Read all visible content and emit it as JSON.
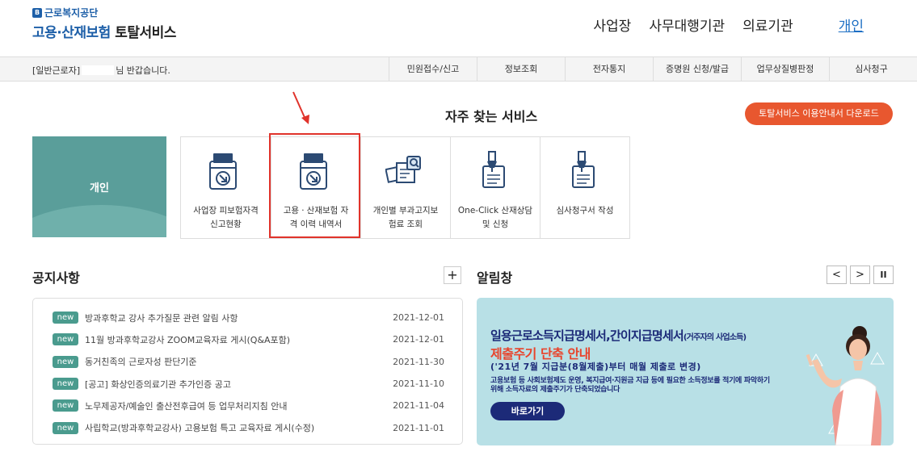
{
  "header": {
    "logo_top": "근로복지공단",
    "logo_main_blue": "고용·산재보험",
    "logo_main_dark": "토탈서비스",
    "nav": [
      "사업장",
      "사무대행기관",
      "의료기관",
      "개인"
    ]
  },
  "subbar": {
    "welcome_prefix": "[일반근로자]",
    "welcome_suffix": "님 반갑습니다.",
    "menu": [
      "민원접수/신고",
      "정보조회",
      "전자통지",
      "증명원 신청/발급",
      "업무상질병판정",
      "심사청구"
    ]
  },
  "favorites": {
    "title": "자주 찾는 서비스",
    "download_label": "토탈서비스 이용안내서 다운로드",
    "personal_label": "개인",
    "items": [
      {
        "line1": "사업장 피보험자격",
        "line2": "신고현황",
        "icon": "folder-arrow-icon"
      },
      {
        "line1": "고용ㆍ산재보험 자",
        "line2": "격 이력 내역서",
        "icon": "folder-arrow-icon"
      },
      {
        "line1": "개인별 부과고지보",
        "line2": "험료 조회",
        "icon": "document-search-icon"
      },
      {
        "line1": "One-Click 산재상담",
        "line2": "및 신청",
        "icon": "pen-document-icon"
      },
      {
        "line1": "심사청구서 작성",
        "line2": "",
        "icon": "pen-document-icon"
      }
    ]
  },
  "notices": {
    "title": "공지사항",
    "more": "+",
    "badge": "new",
    "items": [
      {
        "title": "방과후학교 강사 추가질문 관련 알림 사항",
        "date": "2021-12-01"
      },
      {
        "title": "11월 방과후학교강사 ZOOM교육자료 게시(Q&A포함)",
        "date": "2021-12-01"
      },
      {
        "title": "동거친족의 근로자성 판단기준",
        "date": "2021-11-30"
      },
      {
        "title": "[공고] 화상인증의료기관 추가인증 공고",
        "date": "2021-11-10"
      },
      {
        "title": "노무제공자/예술인 출산전후급여 등 업무처리지침 안내",
        "date": "2021-11-04"
      },
      {
        "title": "사립학교(방과후학교강사) 고용보험 특고 교육자료 게시(수정)",
        "date": "2021-11-01"
      }
    ]
  },
  "alerts": {
    "title": "알림창",
    "prev": "<",
    "next": ">",
    "pause": "II",
    "banner": {
      "headline": "일용근로소득지급명세서,간이지급명세서",
      "headline_small": "(거주자의 사업소득)",
      "subhead": "제출주기 단축 안내",
      "period": "('21년 7월 지급분(8월제출)부터 매월 제출로 변경)",
      "body": "고용보험 등 사회보험제도 운영, 복지급여·지원금 지급 등에 필요한 소득정보를 적기에 파악하기 위해 소득자료의 제출주기가 단축되었습니다",
      "button": "바로가기"
    }
  },
  "colors": {
    "brand": "#1d5fa8",
    "accent": "#e8572f",
    "badge": "#4a9b8e",
    "banner_bg": "#b8e0e6"
  }
}
